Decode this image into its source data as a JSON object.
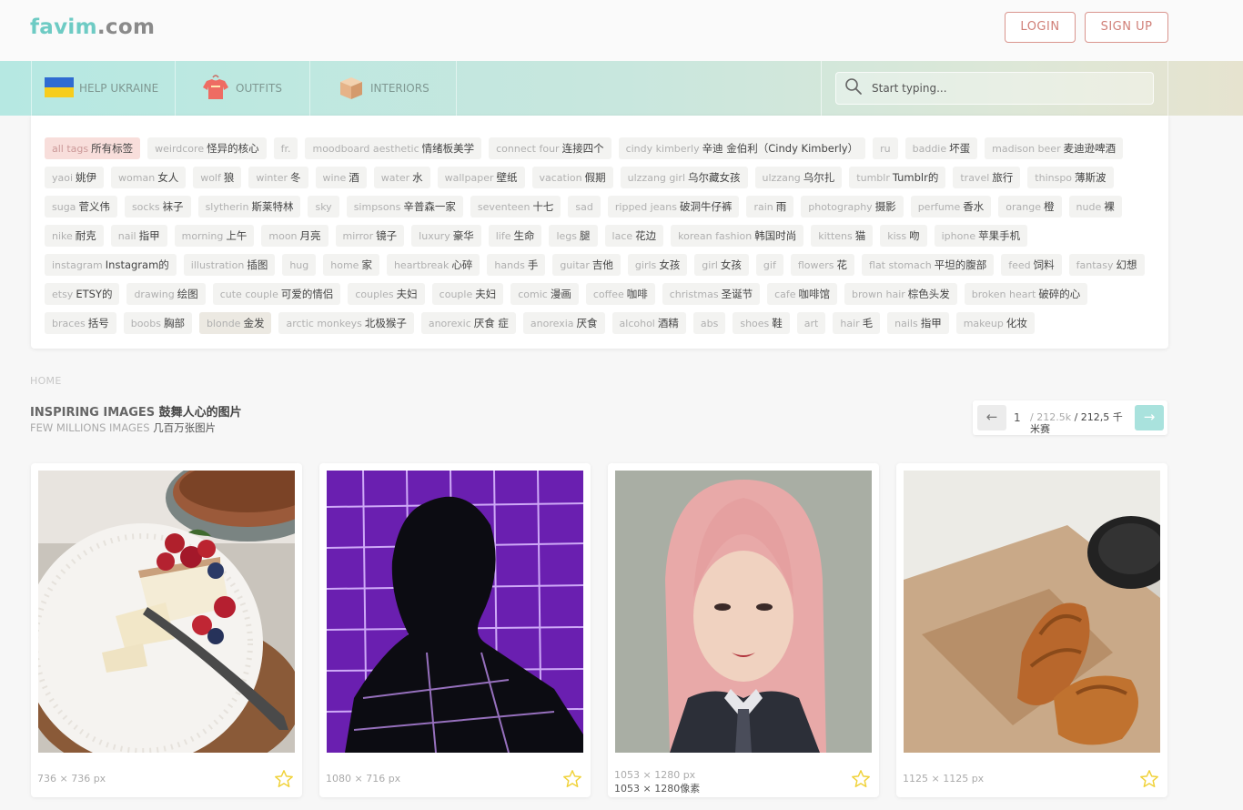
{
  "header": {
    "logo_part1": "favim",
    "logo_part2": ".com",
    "login_label": "LOGIN",
    "signup_label": "SIGN UP"
  },
  "nav": {
    "items": [
      {
        "label": "HELP UKRAINE",
        "icon": "ukraine-flag-icon"
      },
      {
        "label": "OUTFITS",
        "icon": "tshirt-icon"
      },
      {
        "label": "INTERIORS",
        "icon": "box-icon"
      }
    ],
    "search_placeholder": "Start typing..."
  },
  "tags": [
    {
      "en": "all tags",
      "zh": "所有标签"
    },
    {
      "en": "weirdcore",
      "zh": "怪异的核心"
    },
    {
      "en": "fr.",
      "zh": ""
    },
    {
      "en": "moodboard aesthetic",
      "zh": "情绪板美学"
    },
    {
      "en": "connect four",
      "zh": "连接四个"
    },
    {
      "en": "cindy kimberly",
      "zh": "辛迪 金伯利（Cindy Kimberly）"
    },
    {
      "en": "ru",
      "zh": ""
    },
    {
      "en": "baddie",
      "zh": "坏蛋"
    },
    {
      "en": "madison beer",
      "zh": "麦迪逊啤酒"
    },
    {
      "en": "yaoi",
      "zh": "姚伊"
    },
    {
      "en": "woman",
      "zh": "女人"
    },
    {
      "en": "wolf",
      "zh": "狼"
    },
    {
      "en": "winter",
      "zh": "冬"
    },
    {
      "en": "wine",
      "zh": "酒"
    },
    {
      "en": "water",
      "zh": "水"
    },
    {
      "en": "wallpaper",
      "zh": "壁纸"
    },
    {
      "en": "vacation",
      "zh": "假期"
    },
    {
      "en": "ulzzang girl",
      "zh": "乌尔藏女孩"
    },
    {
      "en": "ulzzang",
      "zh": "乌尔扎"
    },
    {
      "en": "tumblr",
      "zh": "Tumblr的"
    },
    {
      "en": "travel",
      "zh": "旅行"
    },
    {
      "en": "thinspo",
      "zh": "薄斯波"
    },
    {
      "en": "suga",
      "zh": "菅义伟"
    },
    {
      "en": "socks",
      "zh": "袜子"
    },
    {
      "en": "slytherin",
      "zh": "斯莱特林"
    },
    {
      "en": "sky",
      "zh": ""
    },
    {
      "en": "simpsons",
      "zh": "辛普森一家"
    },
    {
      "en": "seventeen",
      "zh": "十七"
    },
    {
      "en": "sad",
      "zh": ""
    },
    {
      "en": "ripped jeans",
      "zh": "破洞牛仔裤"
    },
    {
      "en": "rain",
      "zh": "雨"
    },
    {
      "en": "photography",
      "zh": "摄影"
    },
    {
      "en": "perfume",
      "zh": "香水"
    },
    {
      "en": "orange",
      "zh": "橙"
    },
    {
      "en": "nude",
      "zh": "裸"
    },
    {
      "en": "nike",
      "zh": "耐克"
    },
    {
      "en": "nail",
      "zh": "指甲"
    },
    {
      "en": "morning",
      "zh": "上午"
    },
    {
      "en": "moon",
      "zh": "月亮"
    },
    {
      "en": "mirror",
      "zh": "镜子"
    },
    {
      "en": "luxury",
      "zh": "豪华"
    },
    {
      "en": "life",
      "zh": "生命"
    },
    {
      "en": "legs",
      "zh": "腿"
    },
    {
      "en": "lace",
      "zh": "花边"
    },
    {
      "en": "korean fashion",
      "zh": "韩国时尚"
    },
    {
      "en": "kittens",
      "zh": "猫"
    },
    {
      "en": "kiss",
      "zh": "吻"
    },
    {
      "en": "iphone",
      "zh": "苹果手机"
    },
    {
      "en": "instagram",
      "zh": "Instagram的"
    },
    {
      "en": "illustration",
      "zh": "插图"
    },
    {
      "en": "hug",
      "zh": ""
    },
    {
      "en": "home",
      "zh": "家"
    },
    {
      "en": "heartbreak",
      "zh": "心碎"
    },
    {
      "en": "hands",
      "zh": "手"
    },
    {
      "en": "guitar",
      "zh": "吉他"
    },
    {
      "en": "girls",
      "zh": "女孩"
    },
    {
      "en": "girl",
      "zh": "女孩"
    },
    {
      "en": "gif",
      "zh": ""
    },
    {
      "en": "flowers",
      "zh": "花"
    },
    {
      "en": "flat stomach",
      "zh": "平坦的腹部"
    },
    {
      "en": "feed",
      "zh": "饲料"
    },
    {
      "en": "fantasy",
      "zh": "幻想"
    },
    {
      "en": "etsy",
      "zh": "ETSY的"
    },
    {
      "en": "drawing",
      "zh": "绘图"
    },
    {
      "en": "cute couple",
      "zh": "可爱的情侣"
    },
    {
      "en": "couples",
      "zh": "夫妇"
    },
    {
      "en": "couple",
      "zh": "夫妇"
    },
    {
      "en": "comic",
      "zh": "漫画"
    },
    {
      "en": "coffee",
      "zh": "咖啡"
    },
    {
      "en": "christmas",
      "zh": "圣诞节"
    },
    {
      "en": "cafe",
      "zh": "咖啡馆"
    },
    {
      "en": "brown hair",
      "zh": "棕色头发"
    },
    {
      "en": "broken heart",
      "zh": "破碎的心"
    },
    {
      "en": "braces",
      "zh": "括号"
    },
    {
      "en": "boobs",
      "zh": "胸部"
    },
    {
      "en": "blonde",
      "zh": "金发"
    },
    {
      "en": "arctic monkeys",
      "zh": "北极猴子"
    },
    {
      "en": "anorexic",
      "zh": "厌食 症"
    },
    {
      "en": "anorexia",
      "zh": "厌食"
    },
    {
      "en": "alcohol",
      "zh": "酒精"
    },
    {
      "en": "abs",
      "zh": ""
    },
    {
      "en": "shoes",
      "zh": "鞋"
    },
    {
      "en": "art",
      "zh": ""
    },
    {
      "en": "hair",
      "zh": "毛"
    },
    {
      "en": "nails",
      "zh": "指甲"
    },
    {
      "en": "makeup",
      "zh": "化妆"
    }
  ],
  "breadcrumb": "HOME",
  "heading": {
    "title_en": "INSPIRING IMAGES",
    "title_zh": "鼓舞人心的图片",
    "sub_en": "FEW MILLIONS IMAGES",
    "sub_zh": "几百万张图片"
  },
  "pager": {
    "prev": "←",
    "next": "→",
    "current": "1",
    "total_en": "/ 212.5k",
    "total_zh": "/ 212,5 千米赛"
  },
  "cards": [
    {
      "dims": "736 × 736 px",
      "dims_zh": ""
    },
    {
      "dims": "1080 × 716 px",
      "dims_zh": ""
    },
    {
      "dims": "1053 × 1280 px",
      "dims_zh": "1053 × 1280像素"
    },
    {
      "dims": "1125 × 1125 px",
      "dims_zh": ""
    }
  ],
  "colors": {
    "logo_teal": "#6ecbc4",
    "auth_border": "#d9958e",
    "active_tag": "#f8dedb",
    "next_button": "#a9e2dd",
    "star": "#f0d23a"
  }
}
